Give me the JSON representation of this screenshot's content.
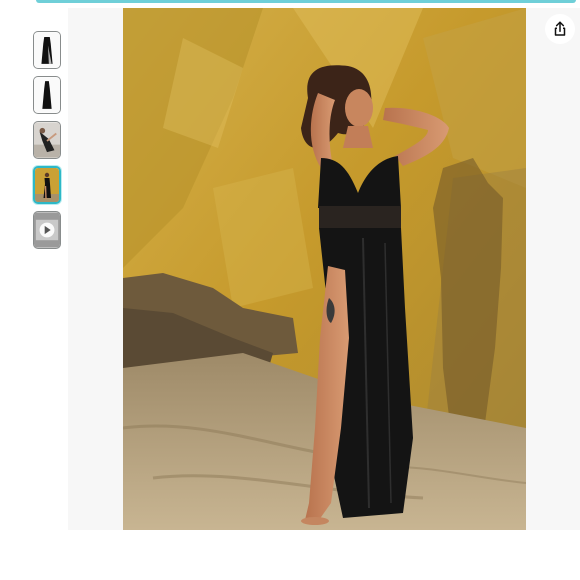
{
  "gallery": {
    "thumbnails": [
      {
        "icon": "dress-front-thumbnail",
        "selected": false
      },
      {
        "icon": "dress-back-thumbnail",
        "selected": false
      },
      {
        "icon": "model-pose-thumbnail",
        "selected": false
      },
      {
        "icon": "beach-photo-thumbnail",
        "selected": true
      },
      {
        "icon": "video-play-thumbnail",
        "selected": false
      }
    ],
    "selected_index": 3,
    "main_image": "model-in-black-maxi-dress-on-beach",
    "share_icon": "share-icon"
  },
  "colors": {
    "accent": "#2db8c7",
    "thumb_border": "#888c8c",
    "rock": "#c9a23a",
    "sand": "#b89e72",
    "dress": "#141414"
  }
}
